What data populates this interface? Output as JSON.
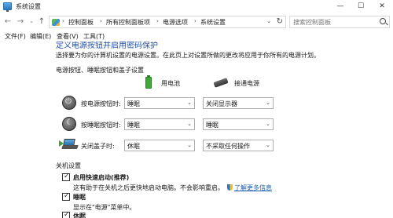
{
  "window": {
    "title": "系统设置",
    "minimize": "—",
    "maximize": "☐",
    "close": "✕"
  },
  "nav": {
    "back": "←",
    "forward": "→",
    "dropdown": "⌄",
    "up": "↑",
    "breadcrumbs": [
      "控制面板",
      "所有控制面板项",
      "电源选项",
      "系统设置"
    ],
    "separator": "›",
    "refresh": "↻",
    "search_placeholder": "搜索控制面板"
  },
  "menu": [
    "文件(F)",
    "编辑(E)",
    "查看(V)",
    "工具(T)"
  ],
  "content": {
    "title_partial": "定义电源按钮并启用密码保护",
    "description": "选择要为你的计算机设置的电源设置。在此页上对设置所做的更改将应用于你所有的电源计划。",
    "section_buttons": "电源按钮、睡眠按钮和盖子设置",
    "col_battery": "用电池",
    "col_plugged": "接通电源",
    "rows": [
      {
        "label": "按电源按钮时:",
        "battery": "睡眠",
        "plugged": "关闭显示器"
      },
      {
        "label": "按睡眠按钮时:",
        "battery": "睡眠",
        "plugged": "睡眠"
      },
      {
        "label": "关闭盖子时:",
        "battery": "休眠",
        "plugged": "不采取任何操作"
      }
    ],
    "section_shutdown": "关机设置",
    "fast_startup_label": "启用快速启动(推荐)",
    "fast_startup_desc": "这有助于在关机之后更快地启动电脑。不会影响重启。",
    "learn_more": "了解更多信息",
    "sleep_label": "睡眠",
    "sleep_desc": "显示在\"电源\"菜单中。",
    "hibernate_label": "休眠"
  }
}
